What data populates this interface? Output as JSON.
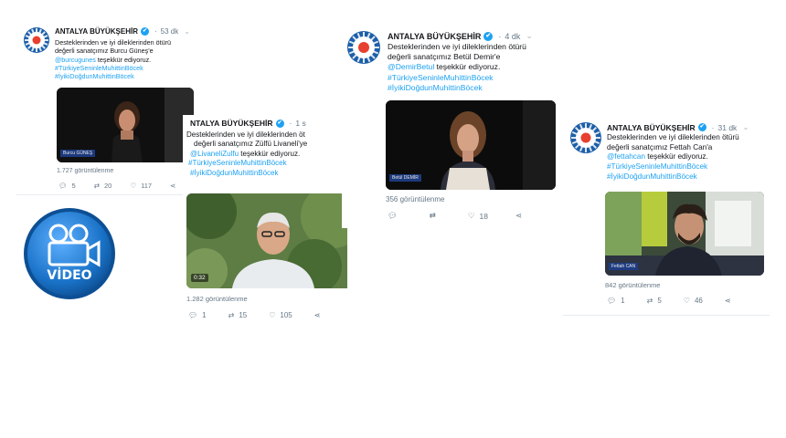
{
  "account": {
    "name": "ANTALYA BÜYÜKŞEHİR",
    "verified_glyph": "✔"
  },
  "icons": {
    "reply": "reply-icon",
    "retweet": "retweet-icon",
    "like": "heart-icon",
    "share": "share-icon",
    "more": "more-icon"
  },
  "tweets": [
    {
      "time": "53 dk",
      "line1": "Desteklerinden ve iyi dileklerinden ötürü",
      "line2": "değerli sanatçımız Burcu Güneş'e",
      "mention": "@burcugunes",
      "after_mention": "teşekkür ediyoruz.",
      "tag1": "#TürkiyeSeninleMuhittinBöcek",
      "tag2": "#İyikiDoğdunMuhittinBöcek",
      "video_caption": "Burcu GÜNEŞ",
      "views": "1.727 görüntülenme",
      "reply": "5",
      "retweet": "20",
      "like": "117"
    },
    {
      "time": "1 s",
      "line1": "Desteklerinden ve iyi dileklerinden öt",
      "line2": "değerli sanatçımız Zülfü Livaneli'ye",
      "mention": "@LivaneliZulfu",
      "after_mention": "teşekkür ediyoruz.",
      "tag1": "#TürkiyeSeninleMuhittinBöcek",
      "tag2": "#İyikiDoğdunMuhittinBöcek",
      "video_time": "0:32",
      "views": "1.282 görüntülenme",
      "reply": "1",
      "retweet": "15",
      "like": "105"
    },
    {
      "time": "4 dk",
      "line1": "Desteklerinden ve iyi dileklerinden ötürü",
      "line2": "değerli sanatçımız Betül Demir'e",
      "mention": "@DemirBetul",
      "after_mention": "teşekkür ediyoruz.",
      "tag1": "#TürkiyeSeninleMuhittinBöcek",
      "tag2": "#İyikiDoğdunMuhittinBöcek",
      "video_caption": "Betül DEMİR",
      "views": "356 görüntülenme",
      "reply": "",
      "retweet": "",
      "like": "18"
    },
    {
      "time": "31 dk",
      "line1": "Desteklerinden ve iyi dileklerinden ötürü",
      "line2": "değerli sanatçımız Fettah Can'a",
      "mention": "@fettahcan",
      "after_mention": "teşekkür ediyoruz.",
      "tag1": "#TürkiyeSeninleMuhittinBöcek",
      "tag2": "#İyikiDoğdunMuhittinBöcek",
      "video_caption": "Fettah CAN",
      "views": "842 görüntülenme",
      "reply": "1",
      "retweet": "5",
      "like": "46"
    }
  ],
  "video_badge": {
    "label": "VİDEO",
    "color": "#1a73c8"
  },
  "colors": {
    "link": "#1da1f2",
    "muted": "#657786",
    "brand_blue": "#1d5fa8"
  }
}
